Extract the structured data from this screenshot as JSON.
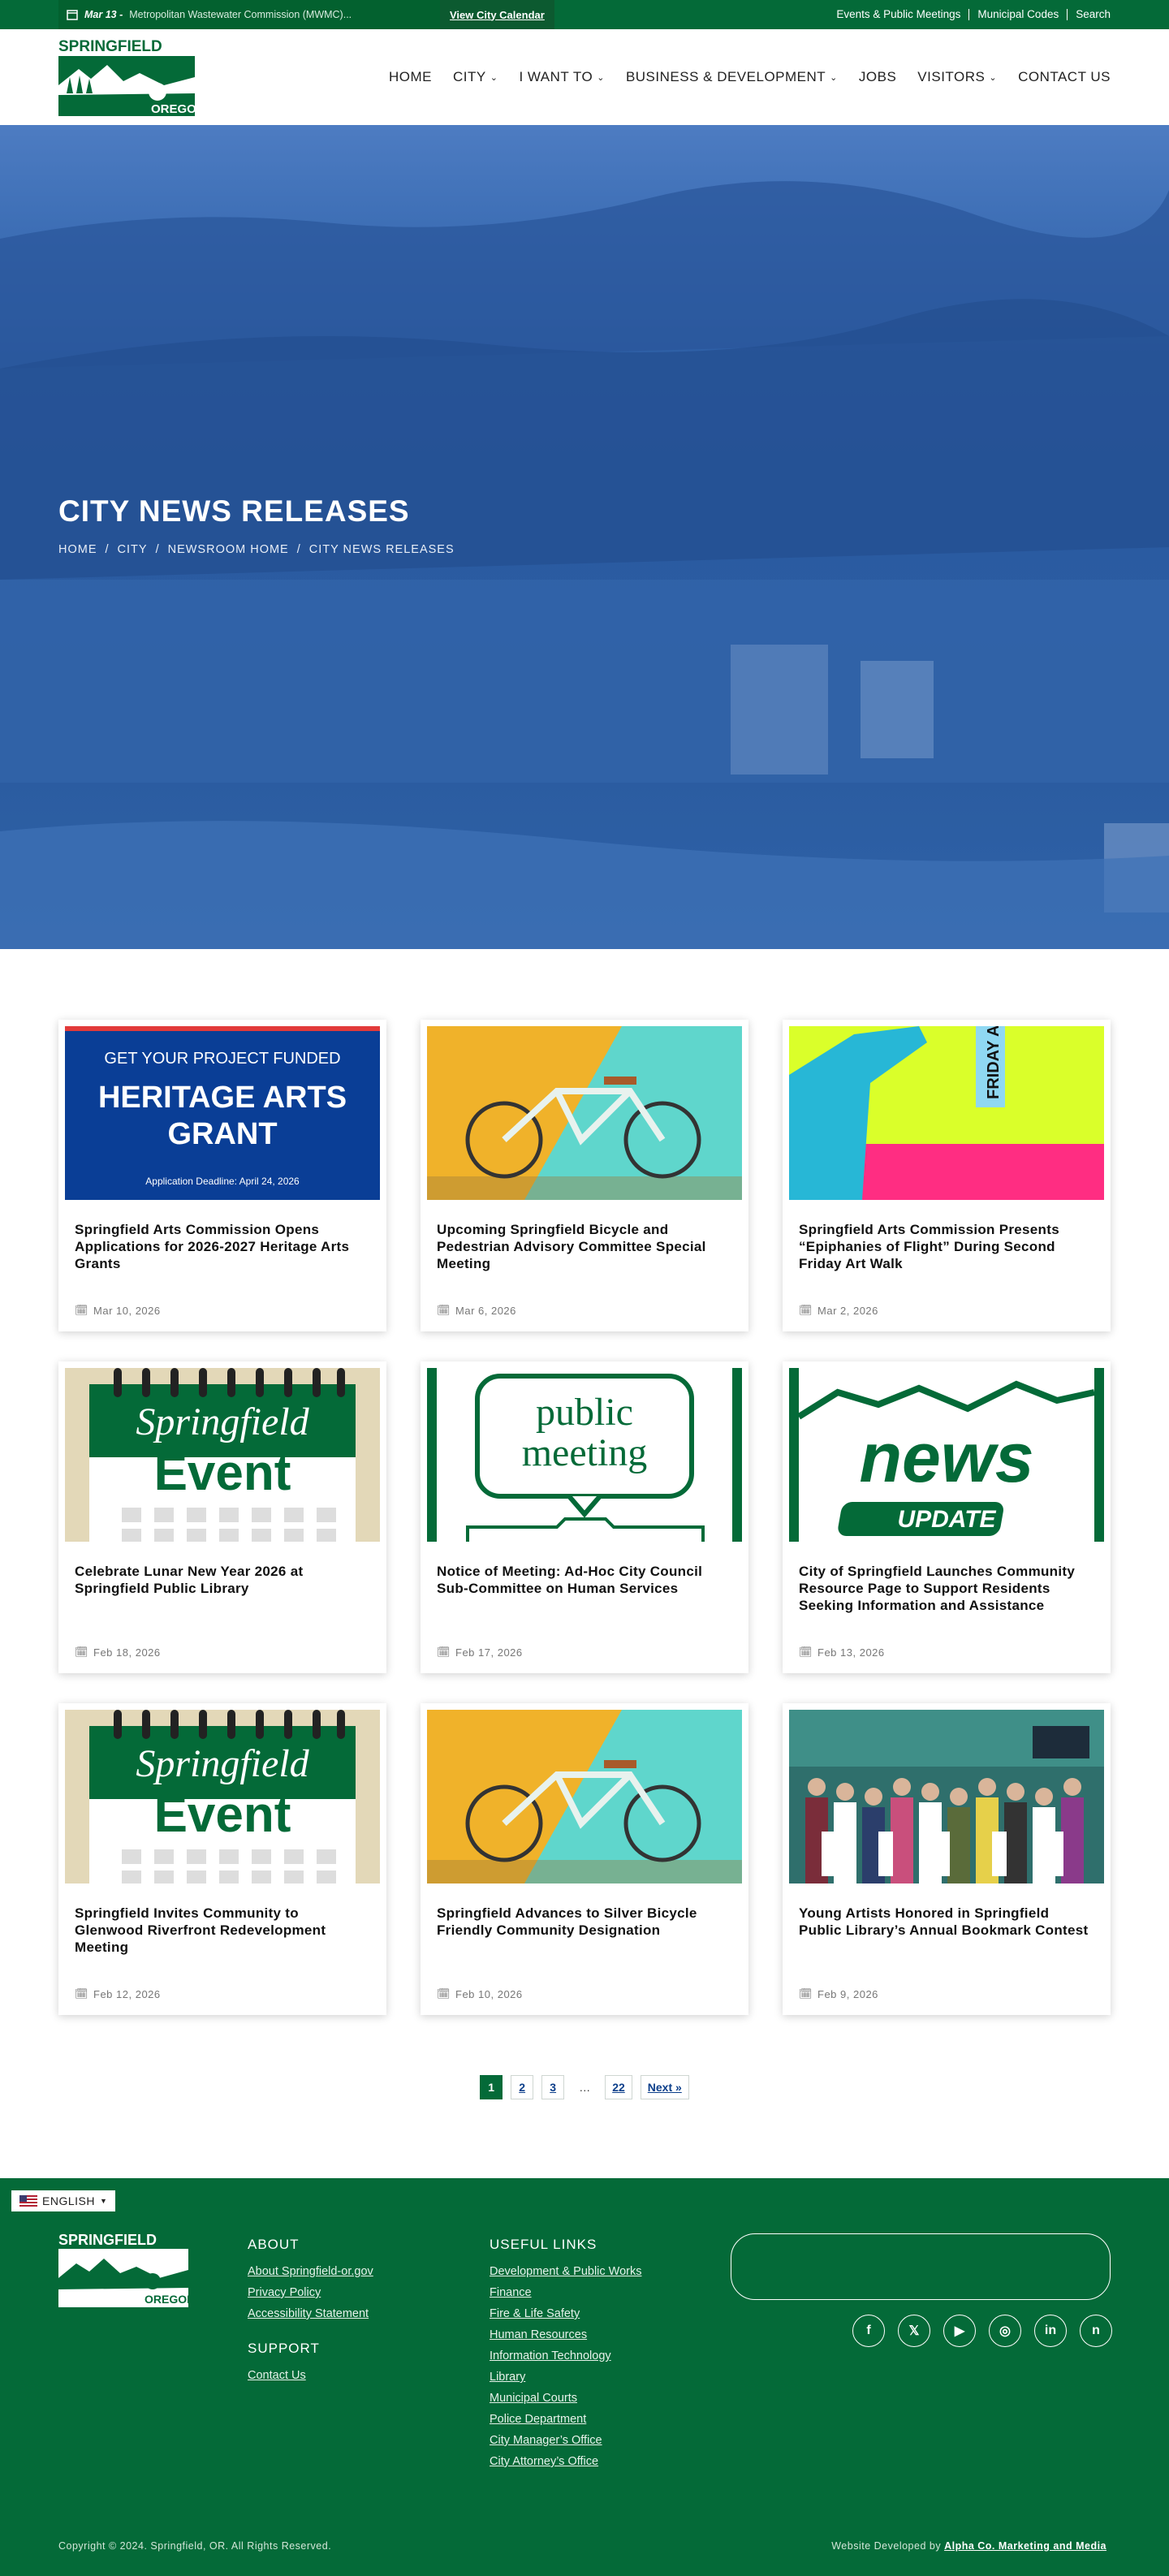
{
  "topbar": {
    "alert_date": "Mar 13 -",
    "alert_text": "Metropolitan Wastewater Commission (MWMC)...",
    "calendar_link": "View City Calendar",
    "links": [
      "Events & Public Meetings",
      "Municipal Codes",
      "Search"
    ]
  },
  "header": {
    "logo_top": "SPRINGFIELD",
    "logo_bottom": "OREGON",
    "nav": [
      {
        "label": "HOME",
        "dropdown": false
      },
      {
        "label": "CITY",
        "dropdown": true
      },
      {
        "label": "I WANT TO",
        "dropdown": true
      },
      {
        "label": "BUSINESS & DEVELOPMENT",
        "dropdown": true
      },
      {
        "label": "JOBS",
        "dropdown": false
      },
      {
        "label": "VISITORS",
        "dropdown": true
      },
      {
        "label": "CONTACT US",
        "dropdown": false
      }
    ]
  },
  "hero": {
    "title": "CITY NEWS RELEASES",
    "breadcrumbs": [
      "HOME",
      "CITY",
      "NEWSROOM HOME",
      "CITY NEWS RELEASES"
    ],
    "separator": "/"
  },
  "thumb_text": {
    "grant_line1": "GET YOUR PROJECT FUNDED",
    "grant_line2": "HERITAGE ARTS",
    "grant_line3": "GRANT",
    "grant_deadline": "Application Deadline: April 24, 2026",
    "event_script": "Springfield",
    "event_word": "Event",
    "public_meeting_1": "public",
    "public_meeting_2": "meeting",
    "news_word": "news",
    "news_update": "UPDATE",
    "friday_walk": "FRIDAY A WALK"
  },
  "cards": [
    {
      "title": "Springfield Arts Commission Opens Applications for 2026-2027 Heritage Arts Grants",
      "date": "Mar 10, 2026",
      "thumb": "grant"
    },
    {
      "title": "Upcoming Springfield Bicycle and Pedestrian Advisory Committee Special Meeting",
      "date": "Mar 6, 2026",
      "thumb": "bike"
    },
    {
      "title": "Springfield Arts Commission Presents “Epiphanies of Flight” During Second Friday Art Walk",
      "date": "Mar 2, 2026",
      "thumb": "artwalk"
    },
    {
      "title": "Celebrate Lunar New Year 2026 at Springfield Public Library",
      "date": "Feb 18, 2026",
      "thumb": "event"
    },
    {
      "title": "Notice of Meeting: Ad-Hoc City Council Sub-Committee on Human Services",
      "date": "Feb 17, 2026",
      "thumb": "meeting"
    },
    {
      "title": "City of Springfield Launches Community Resource Page to Support Residents Seeking Information and Assistance",
      "date": "Feb 13, 2026",
      "thumb": "news"
    },
    {
      "title": "Springfield Invites Community to Glenwood Riverfront Redevelopment Meeting",
      "date": "Feb 12, 2026",
      "thumb": "event"
    },
    {
      "title": "Springfield Advances to Silver Bicycle Friendly Community Designation",
      "date": "Feb 10, 2026",
      "thumb": "bike"
    },
    {
      "title": "Young Artists Honored in Springfield Public Library’s Annual Bookmark Contest",
      "date": "Feb 9, 2026",
      "thumb": "photo"
    }
  ],
  "pagination": {
    "pages": [
      "1",
      "2",
      "3",
      "…",
      "22"
    ],
    "current": "1",
    "next": "Next »"
  },
  "footer": {
    "language": "ENGLISH",
    "about_heading": "ABOUT",
    "about_links": [
      "About Springfield-or.gov",
      "Privacy Policy",
      "Accessibility Statement"
    ],
    "support_heading": "SUPPORT",
    "support_links": [
      "Contact Us"
    ],
    "useful_heading": "USEFUL LINKS",
    "useful_links": [
      "Development & Public Works",
      "Finance",
      "Fire & Life Safety",
      "Human Resources",
      "Information Technology",
      "Library",
      "Municipal Courts",
      "Police Department",
      "City Manager’s Office",
      "City Attorney’s Office"
    ],
    "social": [
      "facebook-icon",
      "x-icon",
      "youtube-icon",
      "instagram-icon",
      "linkedin-icon",
      "nextdoor-icon"
    ],
    "copyright": "Copyright © 2024. Springfield, OR. All Rights Reserved.",
    "developed_prefix": "Website Developed by",
    "developer": "Alpha Co. Marketing and Media"
  },
  "colors": {
    "brand_green": "#046a38",
    "hero_blue": "#2b5ca2",
    "link_blue": "#0b3e8a"
  }
}
